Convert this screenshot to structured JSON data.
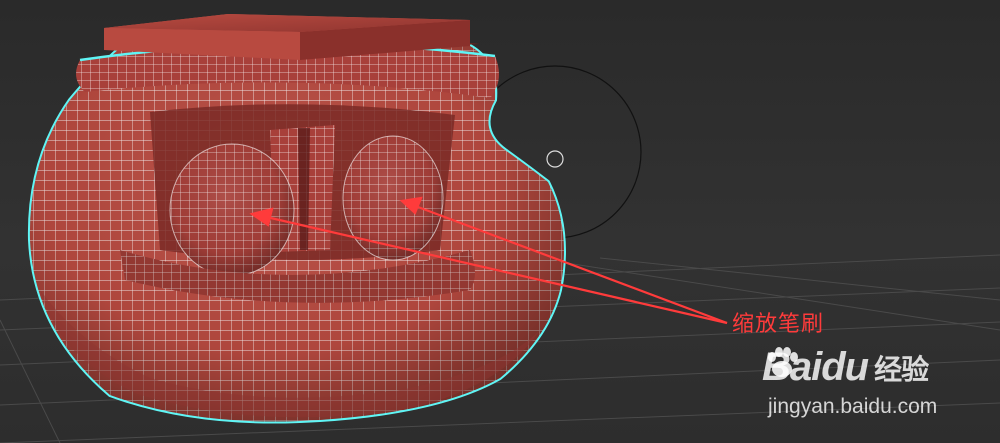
{
  "annotation": {
    "label": "缩放笔刷",
    "color": "#ff3b3b"
  },
  "watermark": {
    "logo_left": "Bai",
    "logo_right": "du",
    "logo_suffix": "经验",
    "url": "jingyan.baidu.com"
  },
  "scene": {
    "mesh_color": "#b5453b",
    "wire_color": "#ffffff",
    "selection_outline_color": "#5ff5f5",
    "brush_cursor_color": "#111111"
  }
}
